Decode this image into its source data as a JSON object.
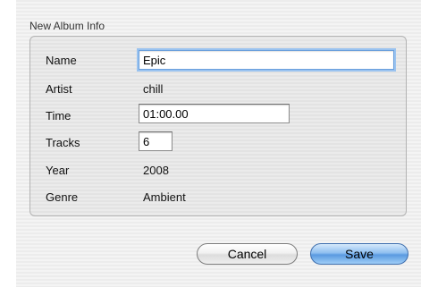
{
  "dialog": {
    "group_title": "New Album Info",
    "fields": {
      "name": {
        "label": "Name",
        "value": "Epic"
      },
      "artist": {
        "label": "Artist",
        "value": "chill"
      },
      "time": {
        "label": "Time",
        "value": "01:00.00"
      },
      "tracks": {
        "label": "Tracks",
        "value": "6"
      },
      "year": {
        "label": "Year",
        "value": "2008"
      },
      "genre": {
        "label": "Genre",
        "value": "Ambient"
      }
    },
    "buttons": {
      "cancel_label": "Cancel",
      "save_label": "Save"
    }
  }
}
